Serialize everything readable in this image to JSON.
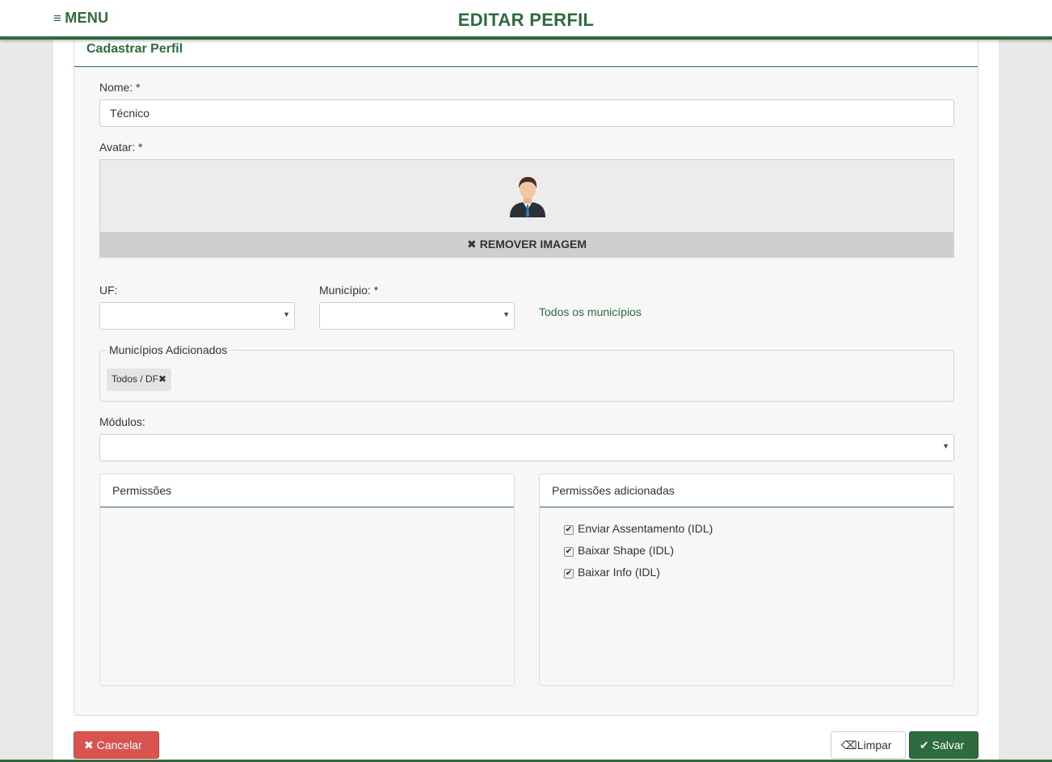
{
  "header": {
    "menu_icon": "≡",
    "menu_label": "MENU",
    "title": "EDITAR PERFIL"
  },
  "panel": {
    "title": "Cadastrar Perfil"
  },
  "form": {
    "name_label": "Nome: *",
    "name_value": "Técnico",
    "avatar_label": "Avatar: *",
    "avatar_icon": "person-avatar-icon",
    "remove_image_label": "REMOVER IMAGEM",
    "uf_label": "UF:",
    "uf_value": "",
    "municipio_label": "Município: *",
    "municipio_value": "",
    "all_municipios_link": "Todos os municípios",
    "added_municipios_legend": "Municípios Adicionados",
    "added_municipios": [
      {
        "label": "Todos / DF"
      }
    ],
    "modules_label": "Módulos:",
    "modules_value": ""
  },
  "permissions": {
    "title": "Permissões",
    "items": []
  },
  "added_permissions": {
    "title": "Permissões adicionadas",
    "items": [
      {
        "label": "Enviar Assentamento (IDL)",
        "checked": true
      },
      {
        "label": "Baixar Shape (IDL)",
        "checked": true
      },
      {
        "label": "Baixar Info (IDL)",
        "checked": true
      }
    ]
  },
  "actions": {
    "cancel_label": "Cancelar",
    "clear_label": "Limpar",
    "save_label": "Salvar"
  },
  "colors": {
    "brand_green": "#2e6b3f",
    "danger_red": "#d9534f"
  }
}
